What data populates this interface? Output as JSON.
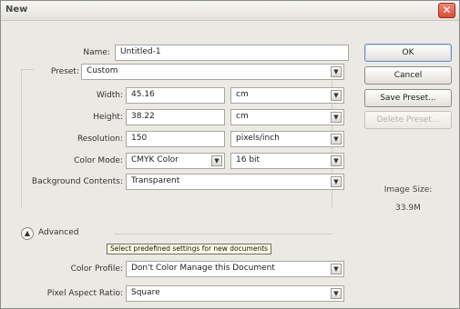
{
  "window": {
    "title": "New",
    "close_glyph": "✕"
  },
  "form": {
    "name": {
      "label": "Name:",
      "value": "Untitled-1"
    },
    "preset": {
      "label": "Preset:",
      "value": "Custom"
    },
    "width": {
      "label": "Width:",
      "value": "45.16",
      "unit": "cm"
    },
    "height": {
      "label": "Height:",
      "value": "38.22",
      "unit": "cm"
    },
    "resolution": {
      "label": "Resolution:",
      "value": "150",
      "unit": "pixels/inch"
    },
    "color_mode": {
      "label": "Color Mode:",
      "value": "CMYK Color",
      "bits": "16 bit"
    },
    "background": {
      "label": "Background Contents:",
      "value": "Transparent"
    },
    "advanced": {
      "label": "Advanced",
      "toggle_glyph": "▲"
    },
    "tooltip": "Select predefined settings for new documents",
    "color_profile": {
      "label": "Color Profile:",
      "value": "Don't Color Manage this Document"
    },
    "pixel_aspect": {
      "label": "Pixel Aspect Ratio:",
      "value": "Square"
    }
  },
  "buttons": {
    "ok": "OK",
    "cancel": "Cancel",
    "save_preset": "Save Preset...",
    "delete_preset": "Delete Preset..."
  },
  "image_size": {
    "label": "Image Size:",
    "value": "33.9M"
  },
  "icons": {
    "dropdown_arrow": "chevron-down-icon"
  },
  "colors": {
    "close_button": "#d94a33",
    "default_button_border": "#6f8fbf",
    "tooltip_bg": "#ffffe1"
  }
}
